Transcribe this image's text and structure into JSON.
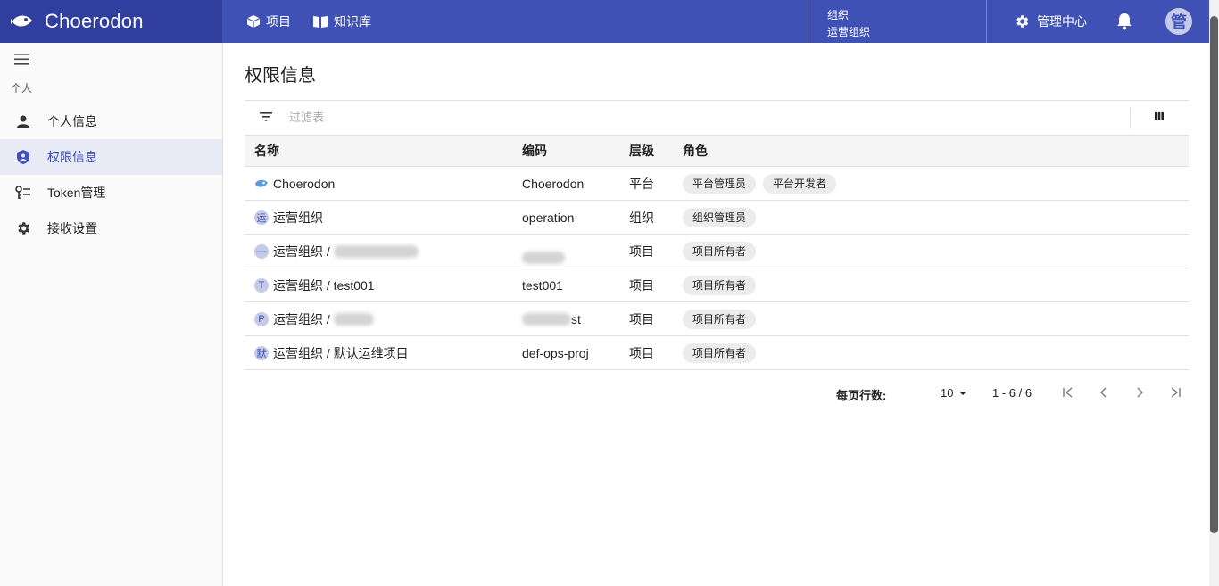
{
  "app": {
    "name": "Choerodon"
  },
  "header": {
    "nav": [
      {
        "label": "项目",
        "icon": "cube-icon"
      },
      {
        "label": "知识库",
        "icon": "book-icon"
      }
    ],
    "org": {
      "caption": "组织",
      "name": "运营组织"
    },
    "admin_label": "管理中心",
    "avatar_initial": "管"
  },
  "sidebar": {
    "group": "个人",
    "items": [
      {
        "label": "个人信息",
        "icon": "person-icon",
        "active": false
      },
      {
        "label": "权限信息",
        "icon": "shield-icon",
        "active": true
      },
      {
        "label": "Token管理",
        "icon": "key-icon",
        "active": false
      },
      {
        "label": "接收设置",
        "icon": "gear-icon",
        "active": false
      }
    ]
  },
  "main": {
    "title": "权限信息",
    "filter_placeholder": "过滤表",
    "columns": {
      "name": "名称",
      "code": "编码",
      "level": "层级",
      "role": "角色"
    },
    "rows": [
      {
        "icon": "fish-icon",
        "icon_text": "",
        "name": "Choerodon",
        "name_blurred": false,
        "code": "Choerodon",
        "code_blurred": false,
        "level": "平台",
        "roles": [
          "平台管理员",
          "平台开发者"
        ]
      },
      {
        "icon": "letter-icon",
        "icon_text": "运",
        "name": "运营组织",
        "name_blurred": false,
        "code": "operation",
        "code_blurred": false,
        "level": "组织",
        "roles": [
          "组织管理员"
        ]
      },
      {
        "icon": "letter-icon",
        "icon_text": "—",
        "name": "运营组织 / ",
        "name_blurred": true,
        "code": "",
        "code_blurred": true,
        "level": "项目",
        "roles": [
          "项目所有者"
        ]
      },
      {
        "icon": "letter-icon",
        "icon_text": "T",
        "name": "运营组织 / test001",
        "name_blurred": false,
        "code": "test001",
        "code_blurred": false,
        "level": "项目",
        "roles": [
          "项目所有者"
        ]
      },
      {
        "icon": "letter-icon",
        "icon_text": "P",
        "name": "运营组织 / ",
        "name_blurred": true,
        "code": "st",
        "code_blurred": true,
        "level": "项目",
        "roles": [
          "项目所有者"
        ]
      },
      {
        "icon": "letter-icon",
        "icon_text": "默",
        "name": "运营组织 / 默认运维项目",
        "name_blurred": false,
        "code": "def-ops-proj",
        "code_blurred": false,
        "level": "项目",
        "roles": [
          "项目所有者"
        ]
      }
    ],
    "pagination": {
      "label": "每页行数:",
      "page_size": "10",
      "range": "1 - 6 / 6"
    }
  },
  "colors": {
    "header": "#3f51b5",
    "logo_bg": "#303f9f",
    "active_bg": "#e8eaf6",
    "accent": "#3f51b5"
  }
}
